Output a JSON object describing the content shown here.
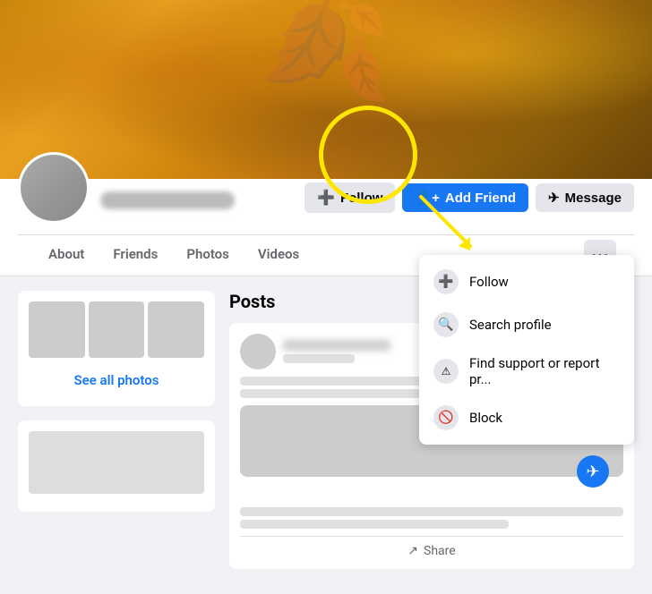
{
  "cover": {
    "alt": "Autumn tree cover photo"
  },
  "profile": {
    "name_placeholder": "User Name",
    "avatar_alt": "Profile avatar"
  },
  "actions": {
    "follow_label": "Follow",
    "add_friend_label": "Add Friend",
    "message_label": "Message"
  },
  "nav": {
    "tabs": [
      {
        "label": "About",
        "active": false
      },
      {
        "label": "Friends",
        "active": false
      },
      {
        "label": "Photos",
        "active": false
      },
      {
        "label": "Videos",
        "active": false
      }
    ],
    "more_label": "···"
  },
  "posts": {
    "header": "Posts"
  },
  "dropdown": {
    "items": [
      {
        "id": "follow",
        "label": "Follow",
        "icon": "➕"
      },
      {
        "id": "search-profile",
        "label": "Search profile",
        "icon": "🔍"
      },
      {
        "id": "find-support",
        "label": "Find support or report pr...",
        "icon": "⚠"
      },
      {
        "id": "block",
        "label": "Block",
        "icon": "🚫"
      }
    ]
  },
  "photos_section": {
    "see_all_label": "See all photos"
  },
  "post_actions": {
    "share_label": "Share"
  }
}
